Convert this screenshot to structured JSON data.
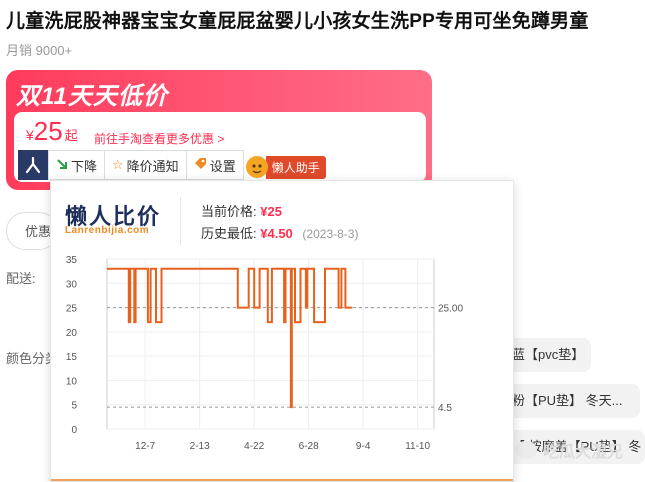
{
  "product": {
    "title": "儿童洗屁股神器宝宝女童屁屁盆婴儿小孩女生洗PP专用可坐免蹲男童",
    "sales": "月销 9000+"
  },
  "promo": {
    "banner": "双11天天低价",
    "currency": "¥",
    "price": "25",
    "price_suffix": "起",
    "link": "前往手淘查看更多优惠 >"
  },
  "toolbar": {
    "down_label": "下降",
    "notify_label": "降价通知",
    "settings_label": "设置",
    "helper_label": "懒人助手"
  },
  "page_left": {
    "coupon": "优惠",
    "delivery": "配送:",
    "color": "颜色分类"
  },
  "options": [
    "蓝【pvc垫】",
    "粉【PU垫】 冬天...",
    "【 按摩盖【PU垫】 冬"
  ],
  "watermark": "吃瓜大湿兄",
  "popup": {
    "brand_cn": "懒人比价",
    "brand_en": "Lanrenbijia.com",
    "current_label": "当前价格:",
    "current_value": "¥25",
    "lowest_label": "历史最低:",
    "lowest_value": "¥4.50",
    "lowest_date": "(2023-8-3)"
  },
  "colors": {
    "accent": "#ff2d4f",
    "line": "#e8601c",
    "brand": "#1e2f5c"
  },
  "chart_data": {
    "type": "line",
    "ylim": [
      0,
      35
    ],
    "yticks": [
      0,
      5,
      10,
      15,
      20,
      25,
      30,
      35
    ],
    "xticks": [
      "12-7",
      "2-13",
      "4-22",
      "6-28",
      "9-4",
      "11-10"
    ],
    "x_range": [
      0,
      12
    ],
    "ref_lines": [
      {
        "label": "25.00",
        "value": 25.0
      },
      {
        "label": "4.5",
        "value": 4.5
      }
    ],
    "series": [
      {
        "points": [
          [
            0,
            33
          ],
          [
            0.8,
            33
          ],
          [
            0.8,
            22
          ],
          [
            0.85,
            22
          ],
          [
            0.85,
            33
          ],
          [
            1.0,
            33
          ],
          [
            1.0,
            22
          ],
          [
            1.05,
            22
          ],
          [
            1.05,
            33
          ],
          [
            1.5,
            33
          ],
          [
            1.5,
            22
          ],
          [
            1.6,
            22
          ],
          [
            1.6,
            33
          ],
          [
            1.8,
            33
          ],
          [
            1.8,
            22
          ],
          [
            2.0,
            22
          ],
          [
            2.0,
            33
          ],
          [
            4.8,
            33
          ],
          [
            4.8,
            25
          ],
          [
            5.2,
            25
          ],
          [
            5.2,
            33
          ],
          [
            5.4,
            33
          ],
          [
            5.4,
            25
          ],
          [
            5.6,
            25
          ],
          [
            5.6,
            33
          ],
          [
            5.9,
            33
          ],
          [
            5.9,
            22
          ],
          [
            6.05,
            22
          ],
          [
            6.05,
            33
          ],
          [
            6.5,
            33
          ],
          [
            6.5,
            22
          ],
          [
            6.55,
            22
          ],
          [
            6.55,
            33
          ],
          [
            6.75,
            33
          ],
          [
            6.75,
            4.5
          ],
          [
            6.78,
            4.5
          ],
          [
            6.78,
            33
          ],
          [
            6.9,
            33
          ],
          [
            6.9,
            22
          ],
          [
            7.1,
            22
          ],
          [
            7.1,
            33
          ],
          [
            7.3,
            33
          ],
          [
            7.3,
            25
          ],
          [
            7.35,
            25
          ],
          [
            7.35,
            33
          ],
          [
            7.6,
            33
          ],
          [
            7.6,
            22
          ],
          [
            8.0,
            22
          ],
          [
            8.0,
            33
          ],
          [
            8.5,
            33
          ],
          [
            8.5,
            25
          ],
          [
            8.6,
            25
          ],
          [
            8.6,
            33
          ],
          [
            8.75,
            33
          ],
          [
            8.75,
            25
          ],
          [
            9.0,
            25
          ]
        ]
      }
    ]
  }
}
